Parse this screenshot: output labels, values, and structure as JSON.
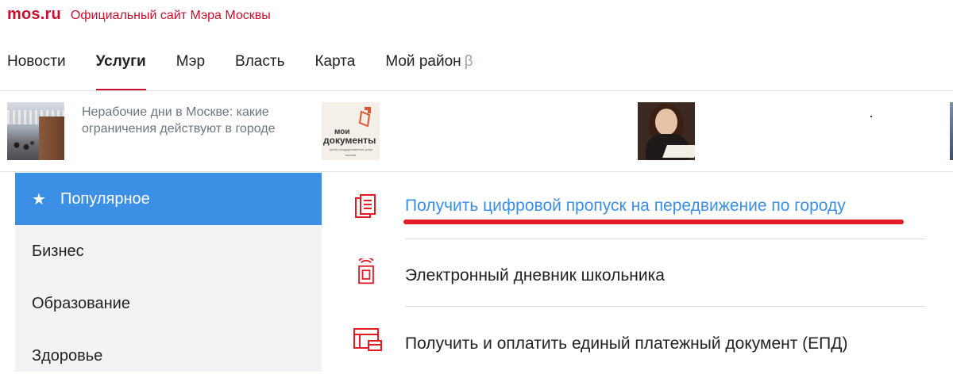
{
  "brand": {
    "logo": "mos.ru",
    "tagline": "Официальный сайт Мэра Москвы"
  },
  "nav": {
    "items": [
      {
        "label": "Новости"
      },
      {
        "label": "Услуги",
        "active": true
      },
      {
        "label": "Мэр"
      },
      {
        "label": "Власть"
      },
      {
        "label": "Карта"
      },
      {
        "label": "Мой район",
        "suffix": "β"
      }
    ]
  },
  "news": {
    "caption": "Нерабочие дни в Москве: какие ограничения действуют в городе",
    "logo_text": {
      "line1": "мои",
      "line2": "документы",
      "line3": "центр государственных услуг",
      "line4": "москва"
    }
  },
  "categories": [
    {
      "label": "Популярное",
      "icon": "star-icon",
      "active": true
    },
    {
      "label": "Бизнес"
    },
    {
      "label": "Образование"
    },
    {
      "label": "Здоровье"
    }
  ],
  "services": [
    {
      "label": "Получить цифровой пропуск на передвижение по городу",
      "icon": "documents-icon",
      "highlighted": true
    },
    {
      "label": "Электронный дневник школьника",
      "icon": "school-diary-icon"
    },
    {
      "label": "Получить и оплатить единый платежный документ (ЕПД)",
      "icon": "payment-document-icon"
    }
  ],
  "colors": {
    "brand_red": "#c8102e",
    "active_blue": "#3b8fe4",
    "link_blue": "#3b8fe4",
    "annotation_red": "#e31b23",
    "sidebar_bg": "#f2f3f4"
  }
}
